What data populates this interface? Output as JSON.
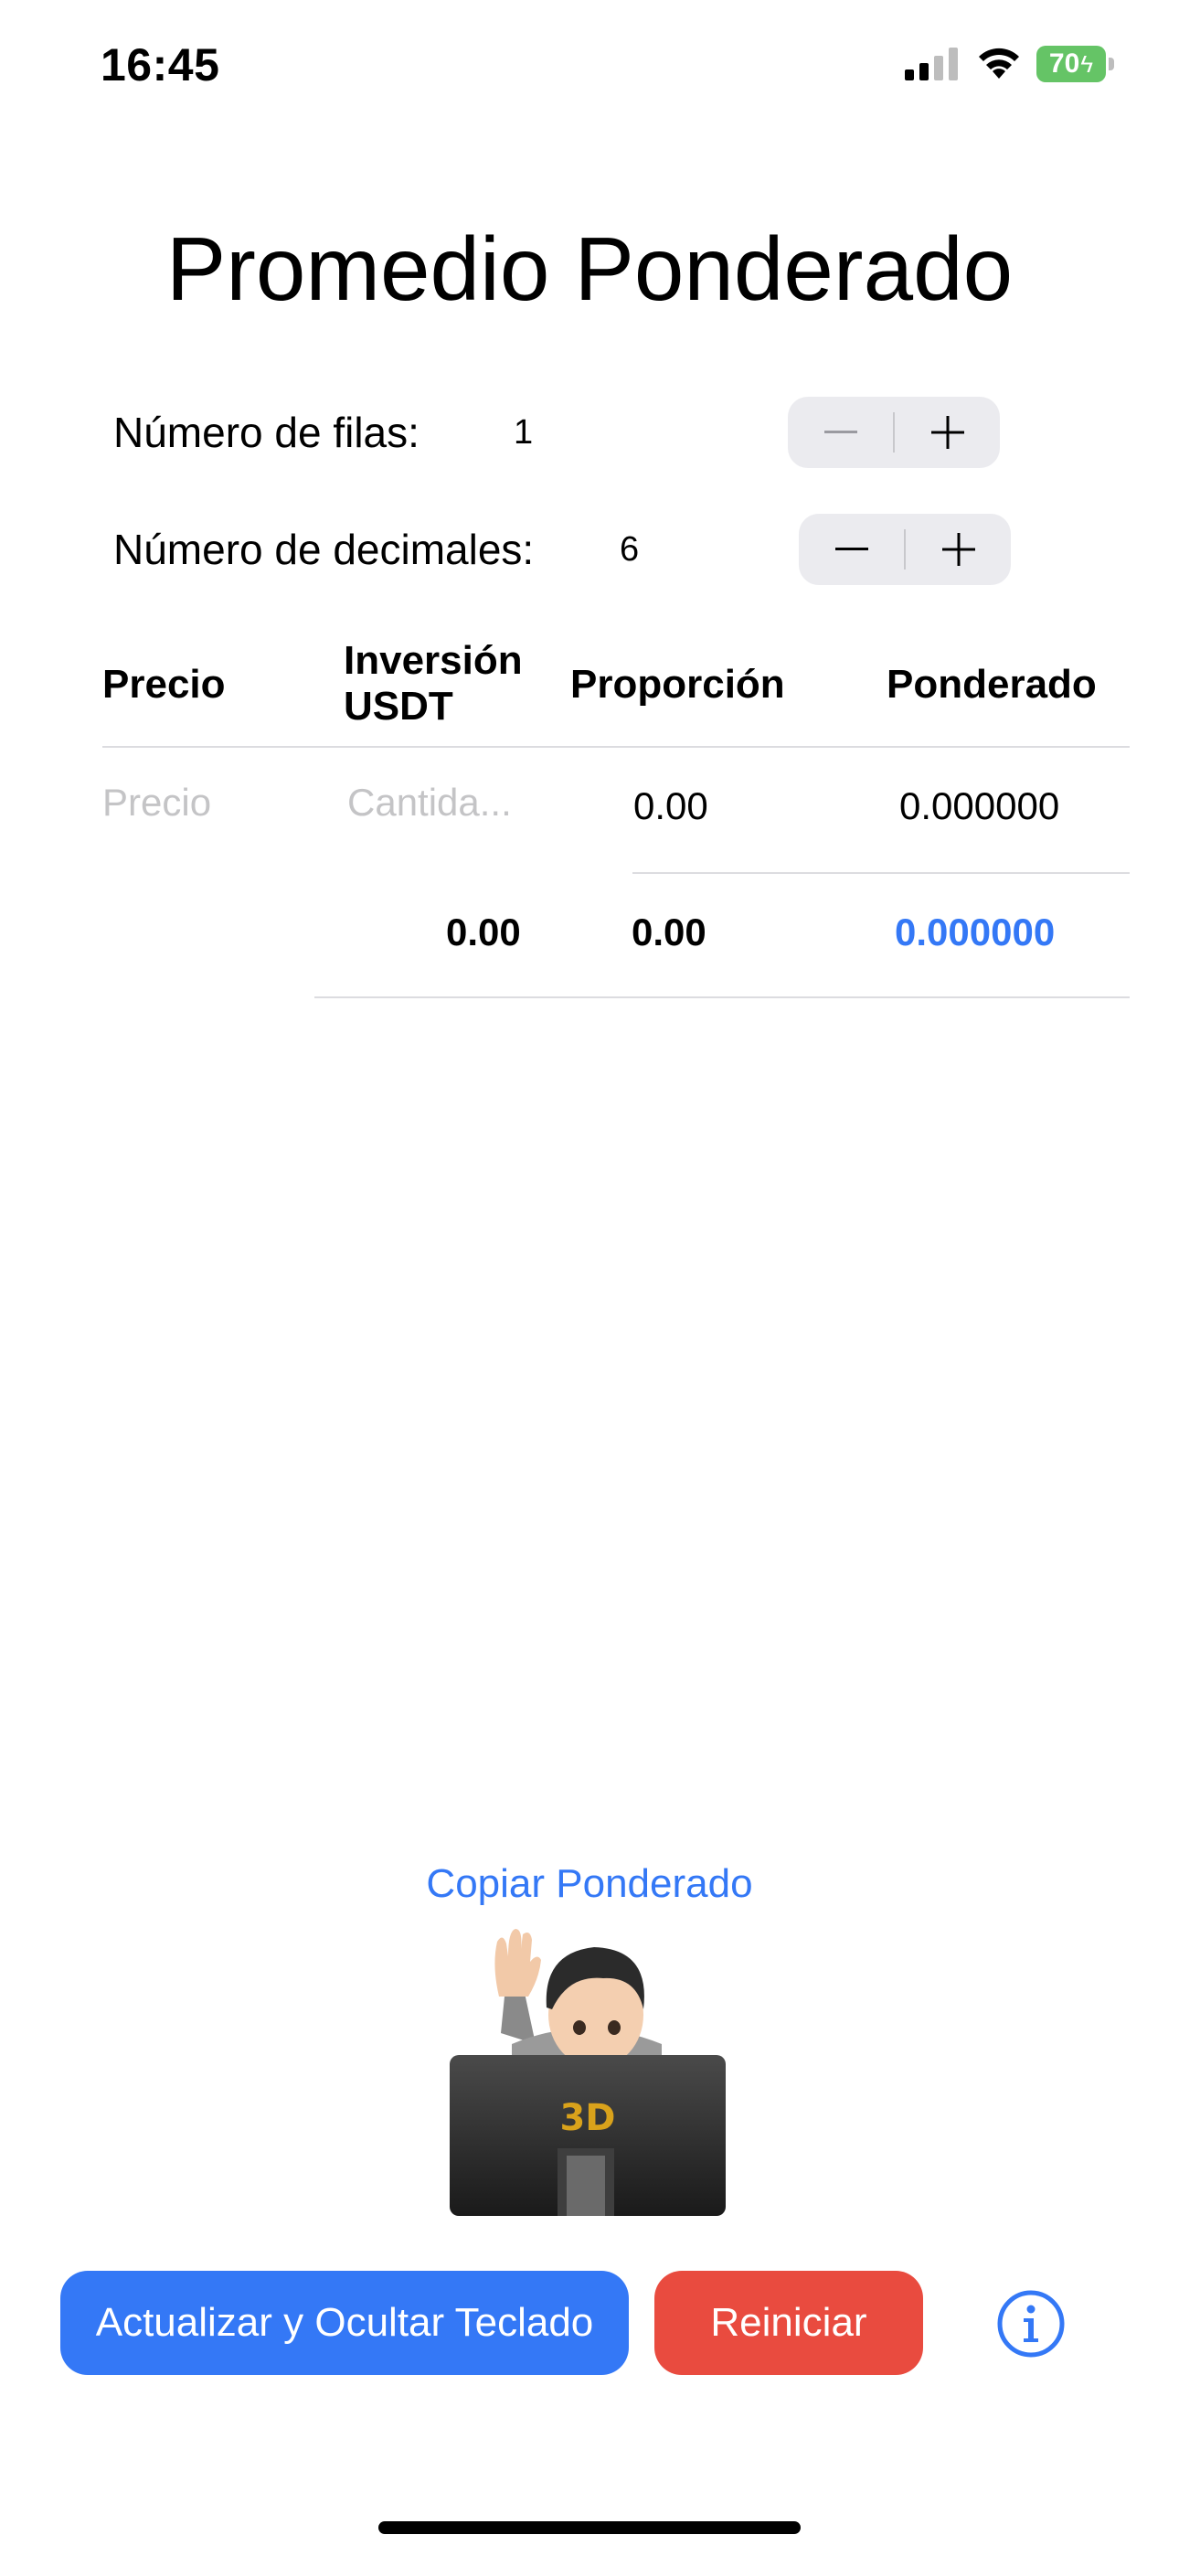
{
  "status_bar": {
    "time": "16:45",
    "battery_level": "70"
  },
  "page": {
    "title": "Promedio Ponderado"
  },
  "settings": {
    "rows": {
      "label": "Número de filas:",
      "value": "1"
    },
    "decimals": {
      "label": "Número de decimales:",
      "value": "6"
    }
  },
  "table": {
    "headers": {
      "price": "Precio",
      "investment_line1": "Inversión",
      "investment_line2": "USDT",
      "proportion": "Proporción",
      "weighted": "Ponderado"
    },
    "rows": [
      {
        "price_placeholder": "Precio",
        "amount_placeholder": "Cantida...",
        "proportion": "0.00",
        "weighted": "0.000000"
      }
    ],
    "totals": {
      "investment": "0.00",
      "proportion": "0.00",
      "weighted": "0.000000"
    }
  },
  "actions": {
    "copy_link": "Copiar Ponderado",
    "update_button": "Actualizar y Ocultar Teclado",
    "reset_button": "Reiniciar",
    "info_icon": "info-circle-icon",
    "mascot_monitor_text": "3D"
  },
  "colors": {
    "accent_blue": "#3478f6",
    "reset_red": "#e94b3f",
    "battery_green": "#65c466",
    "stepper_bg": "#ebebef"
  }
}
